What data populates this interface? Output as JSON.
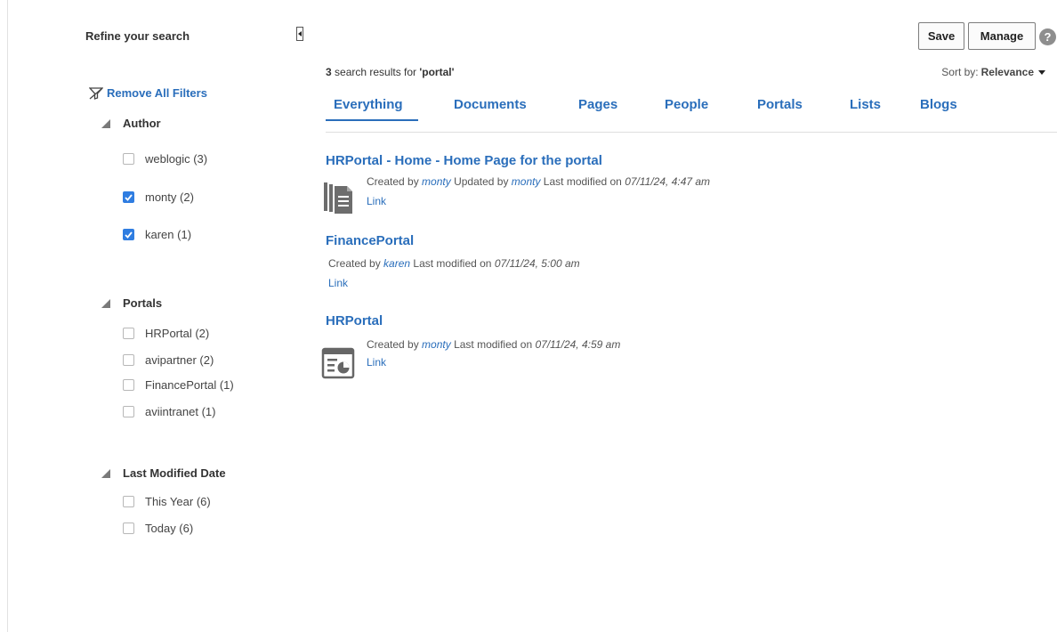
{
  "sidebar": {
    "refine_title": "Refine your search",
    "remove_filters": "Remove All Filters",
    "facets": [
      {
        "label": "Author",
        "options": [
          {
            "label": "weblogic (3)",
            "checked": false
          },
          {
            "label": "monty (2)",
            "checked": true
          },
          {
            "label": "karen (1)",
            "checked": true
          }
        ]
      },
      {
        "label": "Portals",
        "options": [
          {
            "label": "HRPortal (2)",
            "checked": false
          },
          {
            "label": "avipartner (2)",
            "checked": false
          },
          {
            "label": "FinancePortal (1)",
            "checked": false
          },
          {
            "label": "aviintranet (1)",
            "checked": false
          }
        ]
      },
      {
        "label": "Last Modified Date",
        "options": [
          {
            "label": "This Year (6)",
            "checked": false
          },
          {
            "label": "Today (6)",
            "checked": false
          }
        ]
      }
    ]
  },
  "toolbar": {
    "save_label": "Save",
    "manage_label": "Manage",
    "help_label": "?"
  },
  "results": {
    "count": "3",
    "count_text": " search results for ",
    "query": "'portal'",
    "sort_prefix": "Sort by: ",
    "sort_value": "Relevance"
  },
  "tabs": [
    "Everything",
    "Documents",
    "Pages",
    "People",
    "Portals",
    "Lists",
    "Blogs"
  ],
  "active_tab": "Everything",
  "items": [
    {
      "title": "HRPortal - Home - Home Page for the portal",
      "created_by_label": "Created by ",
      "created_by": "monty",
      "updated_by_label": " Updated by ",
      "updated_by": "monty",
      "modified_label": " Last modified on ",
      "modified": "07/11/24, 4:47 am",
      "link": "Link",
      "icon": "pages-icon"
    },
    {
      "title": "FinancePortal",
      "created_by_label": "Created by ",
      "created_by": "karen",
      "modified_label": " Last modified on ",
      "modified": "07/11/24, 5:00 am",
      "link": "Link"
    },
    {
      "title": "HRPortal",
      "created_by_label": "Created by ",
      "created_by": "monty",
      "modified_label": " Last modified on ",
      "modified": "07/11/24, 4:59 am",
      "link": "Link",
      "icon": "portal-icon"
    }
  ],
  "colors": {
    "link": "#2a6ebb",
    "checkbox_checked": "#2f7de1"
  }
}
